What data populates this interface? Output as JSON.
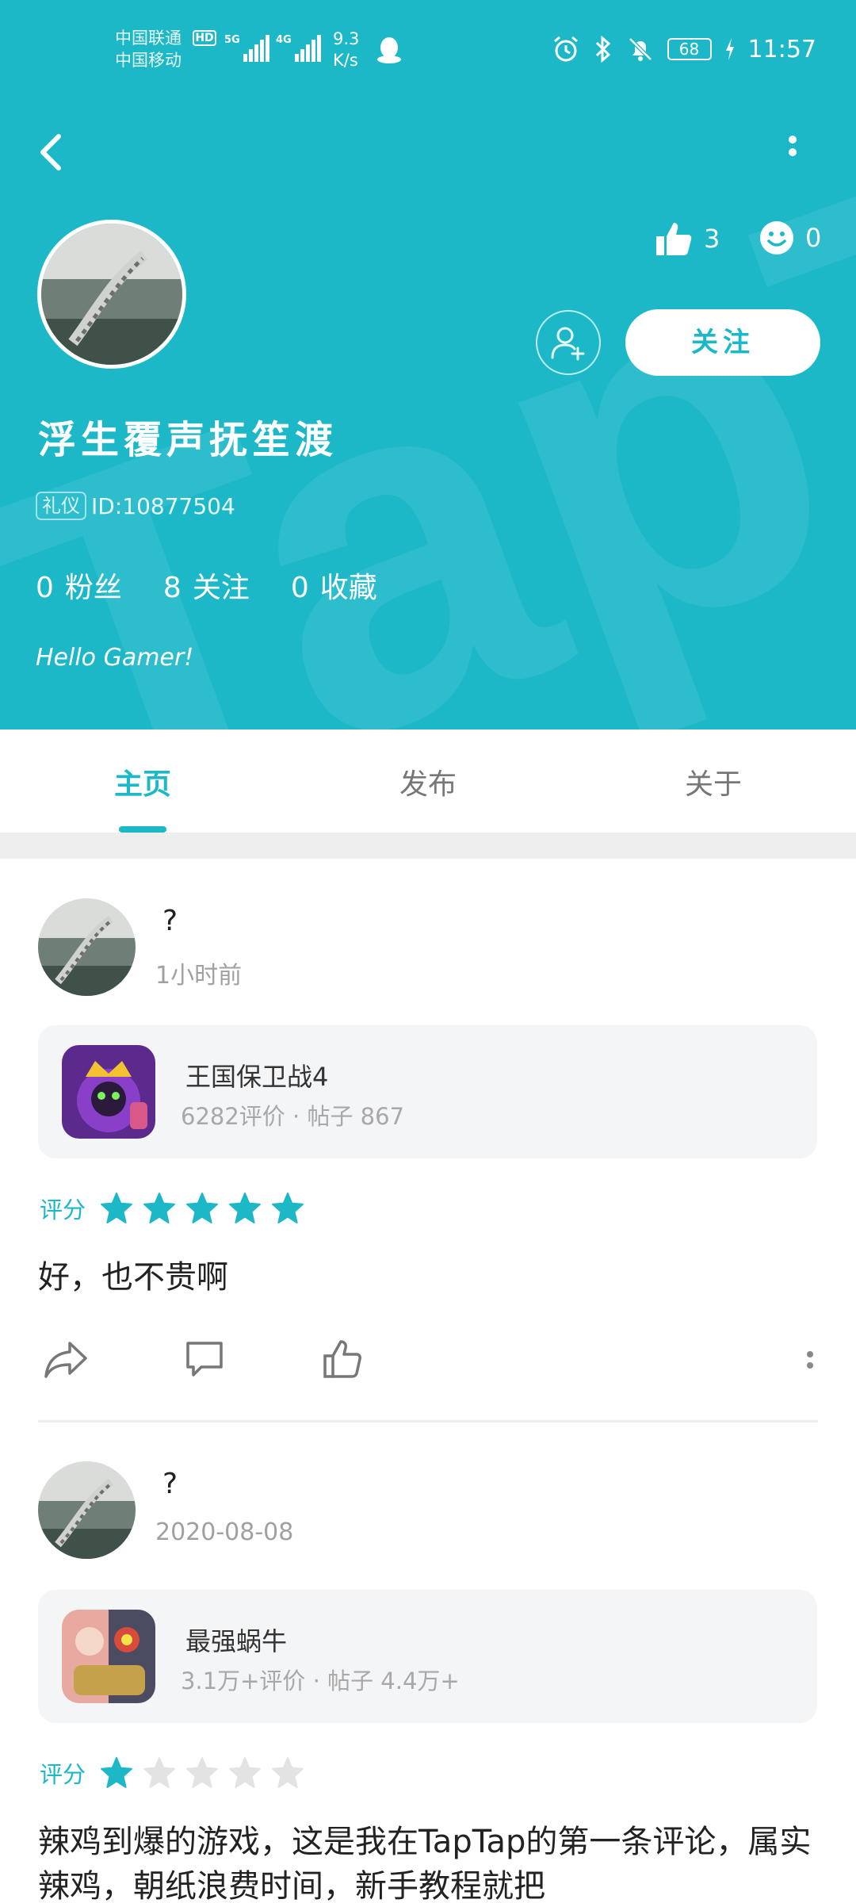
{
  "status_bar": {
    "carrier_1": "中国联通",
    "carrier_2": "中国移动",
    "hd": "HD",
    "net_1": "5G",
    "net_2": "4G",
    "speed_value": "9.3",
    "speed_unit": "K/s",
    "battery": "68",
    "time": "11:57"
  },
  "profile": {
    "username": "浮生覆声抚笙渡",
    "id_badge": "礼仪",
    "id_text": "ID:10877504",
    "likes": "3",
    "smiles": "0",
    "follow_label": "关注",
    "stats": [
      {
        "num": "0",
        "label": "粉丝"
      },
      {
        "num": "8",
        "label": "关注"
      },
      {
        "num": "0",
        "label": "收藏"
      }
    ],
    "bio": "Hello Gamer!"
  },
  "tabs": [
    {
      "label": "主页",
      "active": true
    },
    {
      "label": "发布",
      "active": false
    },
    {
      "label": "关于",
      "active": false
    }
  ],
  "posts": [
    {
      "author": "?",
      "time": "1小时前",
      "game_name": "王国保卫战4",
      "game_meta": "6282评价 · 帖子 867",
      "rating_label": "评分",
      "rating": 5,
      "text": "好，也不贵啊"
    },
    {
      "author": "?",
      "time": "2020-08-08",
      "game_name": "最强蜗牛",
      "game_meta": "3.1万+评价 · 帖子 4.4万+",
      "rating_label": "评分",
      "rating": 1,
      "text": "辣鸡到爆的游戏，这是我在TapTap的第一条评论，属实辣鸡，朝纸浪费时间，新手教程就把"
    }
  ],
  "colors": {
    "accent": "#1db8c8",
    "star_off": "#e3e3e3"
  }
}
